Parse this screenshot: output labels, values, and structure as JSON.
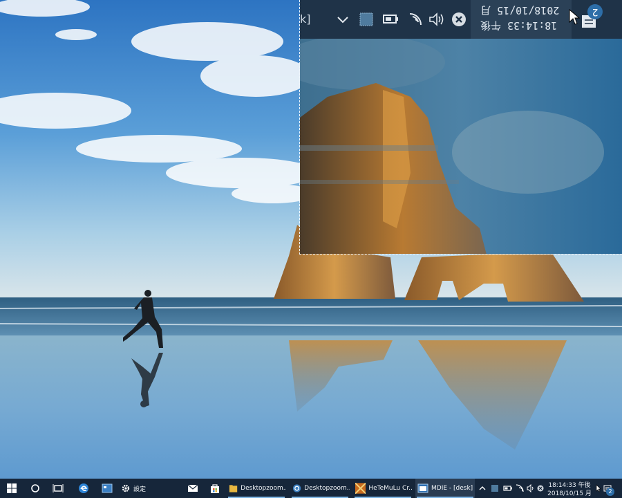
{
  "desktop": {
    "wallpaper": "beach-with-sea-arch-and-runner",
    "colors": {
      "sky_top": "#2f78c4",
      "sky_horizon": "#bcd7e6",
      "rock": "#c78a3c",
      "sea": "#3c6f93",
      "sand": "#7eaed0"
    }
  },
  "zoom_overlay": {
    "edge_glyph": "k]",
    "clock_line1": "2018/10/15 月",
    "clock_line2": "18:14:33 午後",
    "notification_count": "2",
    "icons": [
      "chevron-up-icon",
      "app-tray-icon",
      "battery-icon",
      "wifi-icon",
      "volume-icon",
      "close-circle-icon",
      "notification-icon"
    ]
  },
  "taskbar": {
    "settings_label": "設定",
    "apps": [
      {
        "name": "desktopzoom-folder",
        "label": "Desktopzoom..."
      },
      {
        "name": "desktopzoom-app",
        "label": "Desktopzoom..."
      },
      {
        "name": "hetemulu",
        "label": "HeTeMuLu Cr..."
      },
      {
        "name": "mdie",
        "label": "MDIE - [desk]"
      }
    ],
    "time": "18:14:33 午後",
    "date": "2018/10/15 月",
    "notification_count": "2"
  }
}
